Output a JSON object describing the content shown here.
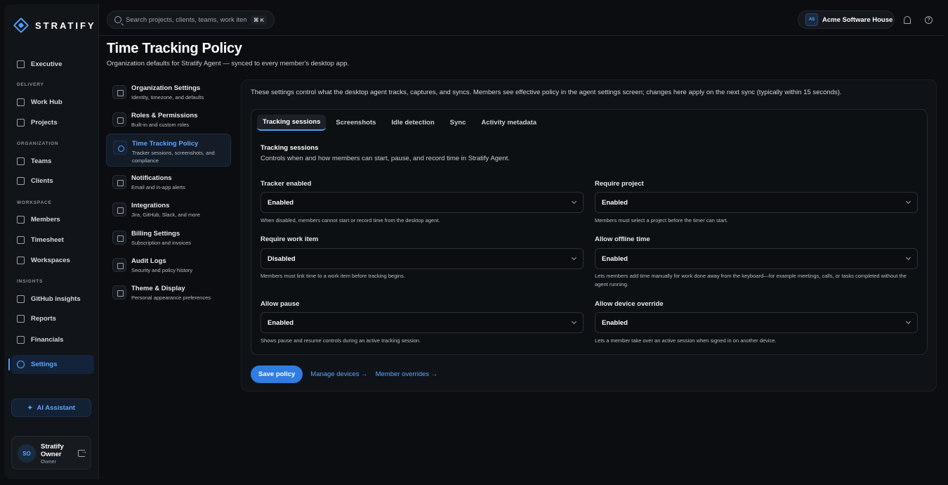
{
  "brand": {
    "name": "STRATIFY"
  },
  "search": {
    "placeholder": "Search projects, clients, teams, work items",
    "shortcut": "⌘ K"
  },
  "org": {
    "initials": "AS",
    "name": "Acme Software House"
  },
  "sidebar": {
    "items": [
      {
        "label": "Executive",
        "icon": "home-icon"
      },
      {
        "section": "DELIVERY"
      },
      {
        "label": "Work Hub",
        "icon": "work-hub-icon"
      },
      {
        "label": "Projects",
        "icon": "projects-icon"
      },
      {
        "section": "ORGANIZATION"
      },
      {
        "label": "Teams",
        "icon": "teams-icon"
      },
      {
        "label": "Clients",
        "icon": "clients-icon"
      },
      {
        "section": "WORKSPACE"
      },
      {
        "label": "Members",
        "icon": "members-icon"
      },
      {
        "label": "Timesheet",
        "icon": "timesheet-icon"
      },
      {
        "label": "Workspaces",
        "icon": "workspaces-icon"
      },
      {
        "section": "INSIGHTS"
      },
      {
        "label": "GitHub insights",
        "icon": "github-icon"
      },
      {
        "label": "Reports",
        "icon": "reports-icon"
      },
      {
        "label": "Financials",
        "icon": "financials-icon"
      },
      {
        "label": "Settings",
        "icon": "gear-icon",
        "active": true
      }
    ],
    "ai_button": "AI Assistant",
    "user": {
      "initials": "SO",
      "name": "Stratify Owner",
      "role": "Owner"
    }
  },
  "page": {
    "title": "Time Tracking Policy",
    "subtitle": "Organization defaults for Stratify Agent — synced to every member's desktop app."
  },
  "settings_nav": [
    {
      "title": "Organization Settings",
      "desc": "Identity, timezone, and defaults"
    },
    {
      "title": "Roles & Permissions",
      "desc": "Built-in and custom roles"
    },
    {
      "title": "Time Tracking Policy",
      "desc": "Tracker sessions, screenshots, and compliance",
      "active": true
    },
    {
      "title": "Notifications",
      "desc": "Email and in-app alerts"
    },
    {
      "title": "Integrations",
      "desc": "Jira, GitHub, Slack, and more"
    },
    {
      "title": "Billing Settings",
      "desc": "Subscription and invoices"
    },
    {
      "title": "Audit Logs",
      "desc": "Security and policy history"
    },
    {
      "title": "Theme & Display",
      "desc": "Personal appearance preferences"
    }
  ],
  "main": {
    "intro": "These settings control what the desktop agent tracks, captures, and syncs. Members see effective policy in the agent settings screen; changes here apply on the next sync (typically within 15 seconds).",
    "tabs": [
      "Tracking sessions",
      "Screenshots",
      "Idle detection",
      "Sync",
      "Activity metadata"
    ],
    "active_tab": "Tracking sessions",
    "section": {
      "title": "Tracking sessions",
      "desc": "Controls when and how members can start, pause, and record time in Stratify Agent."
    },
    "fields": [
      {
        "label": "Tracker enabled",
        "value": "Enabled",
        "help": "When disabled, members cannot start or record time from the desktop agent."
      },
      {
        "label": "Require project",
        "value": "Enabled",
        "help": "Members must select a project before the timer can start."
      },
      {
        "label": "Require work item",
        "value": "Disabled",
        "help": "Members must link time to a work item before tracking begins."
      },
      {
        "label": "Allow offline time",
        "value": "Enabled",
        "help": "Lets members add time manually for work done away from the keyboard—for example meetings, calls, or tasks completed without the agent running."
      },
      {
        "label": "Allow pause",
        "value": "Enabled",
        "help": "Shows pause and resume controls during an active tracking session."
      },
      {
        "label": "Allow device override",
        "value": "Enabled",
        "help": "Lets a member take over an active session when signed in on another device."
      }
    ],
    "save": "Save policy",
    "manage_devices": "Manage devices →",
    "member_overrides": "Member overrides →"
  }
}
